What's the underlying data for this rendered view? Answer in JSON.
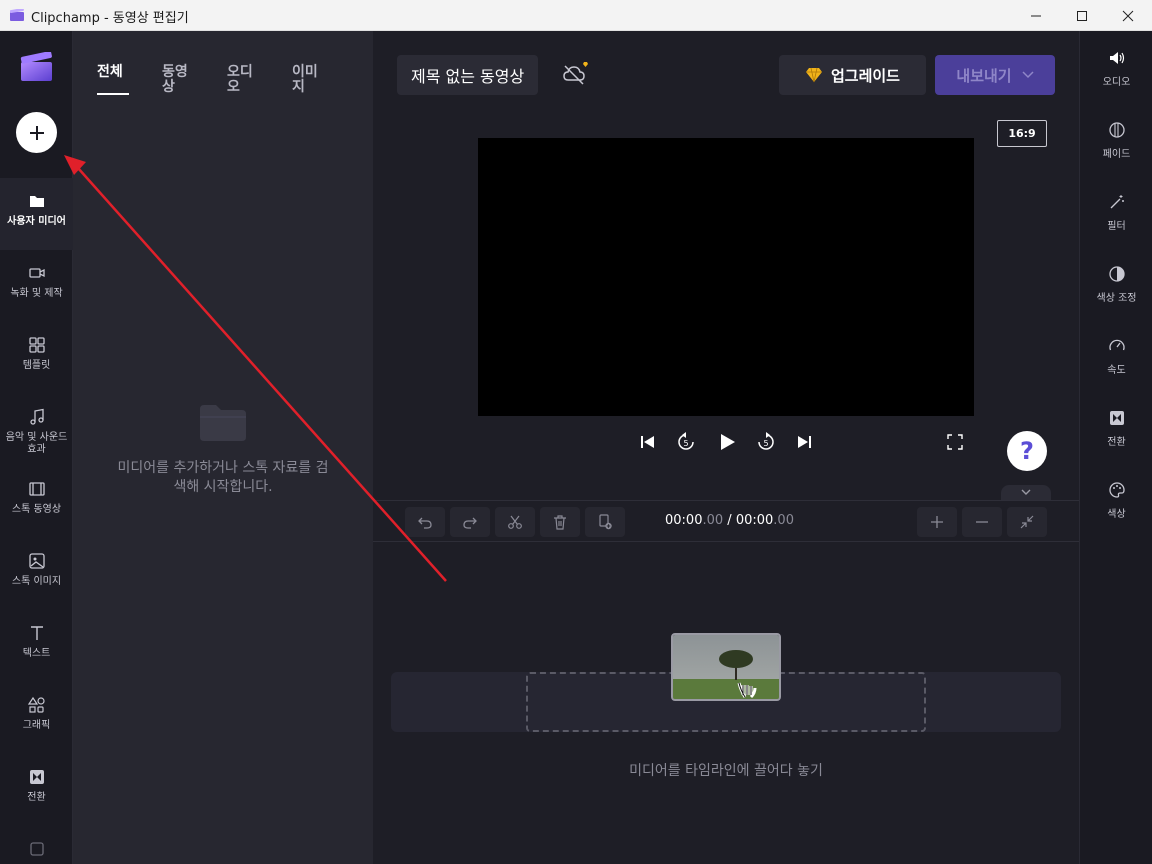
{
  "window": {
    "title": "Clipchamp - 동영상 편집기"
  },
  "left_nav": {
    "items": [
      {
        "label": "사용자 미디어",
        "icon": "folder-icon"
      },
      {
        "label": "녹화 및 제작",
        "icon": "camera-icon"
      },
      {
        "label": "템플릿",
        "icon": "template-icon"
      },
      {
        "label": "음악 및 사운드 효과",
        "icon": "music-icon"
      },
      {
        "label": "스톡 동영상",
        "icon": "film-icon"
      },
      {
        "label": "스톡 이미지",
        "icon": "image-icon"
      },
      {
        "label": "텍스트",
        "icon": "text-icon"
      },
      {
        "label": "그래픽",
        "icon": "shapes-icon"
      },
      {
        "label": "전환",
        "icon": "transition-icon"
      }
    ]
  },
  "media_panel": {
    "tabs": [
      "전체",
      "동영상",
      "오디오",
      "이미지"
    ],
    "active_tab": "전체",
    "empty_text": "미디어를 추가하거나 스톡 자료를 검색해 시작합니다."
  },
  "header": {
    "project_title": "제목 없는 동영상",
    "upgrade_label": "업그레이드",
    "export_label": "내보내기"
  },
  "preview": {
    "aspect_ratio": "16:9"
  },
  "timeline": {
    "current_time": "00:00",
    "current_frac": ".00",
    "separator": "/",
    "total_time": "00:00",
    "total_frac": ".00",
    "drop_text": "미디어를 타임라인에 끌어다 놓기"
  },
  "right_panel": {
    "items": [
      {
        "label": "오디오",
        "icon": "speaker-icon"
      },
      {
        "label": "페이드",
        "icon": "fade-icon"
      },
      {
        "label": "필터",
        "icon": "magic-wand-icon"
      },
      {
        "label": "색상 조정",
        "icon": "contrast-icon"
      },
      {
        "label": "속도",
        "icon": "speedometer-icon"
      },
      {
        "label": "전환",
        "icon": "transition-icon"
      },
      {
        "label": "색상",
        "icon": "palette-icon"
      }
    ]
  },
  "colors": {
    "accent": "#4b3f9a",
    "annotation_arrow": "#e0202a",
    "help": "#5b4ed6"
  }
}
